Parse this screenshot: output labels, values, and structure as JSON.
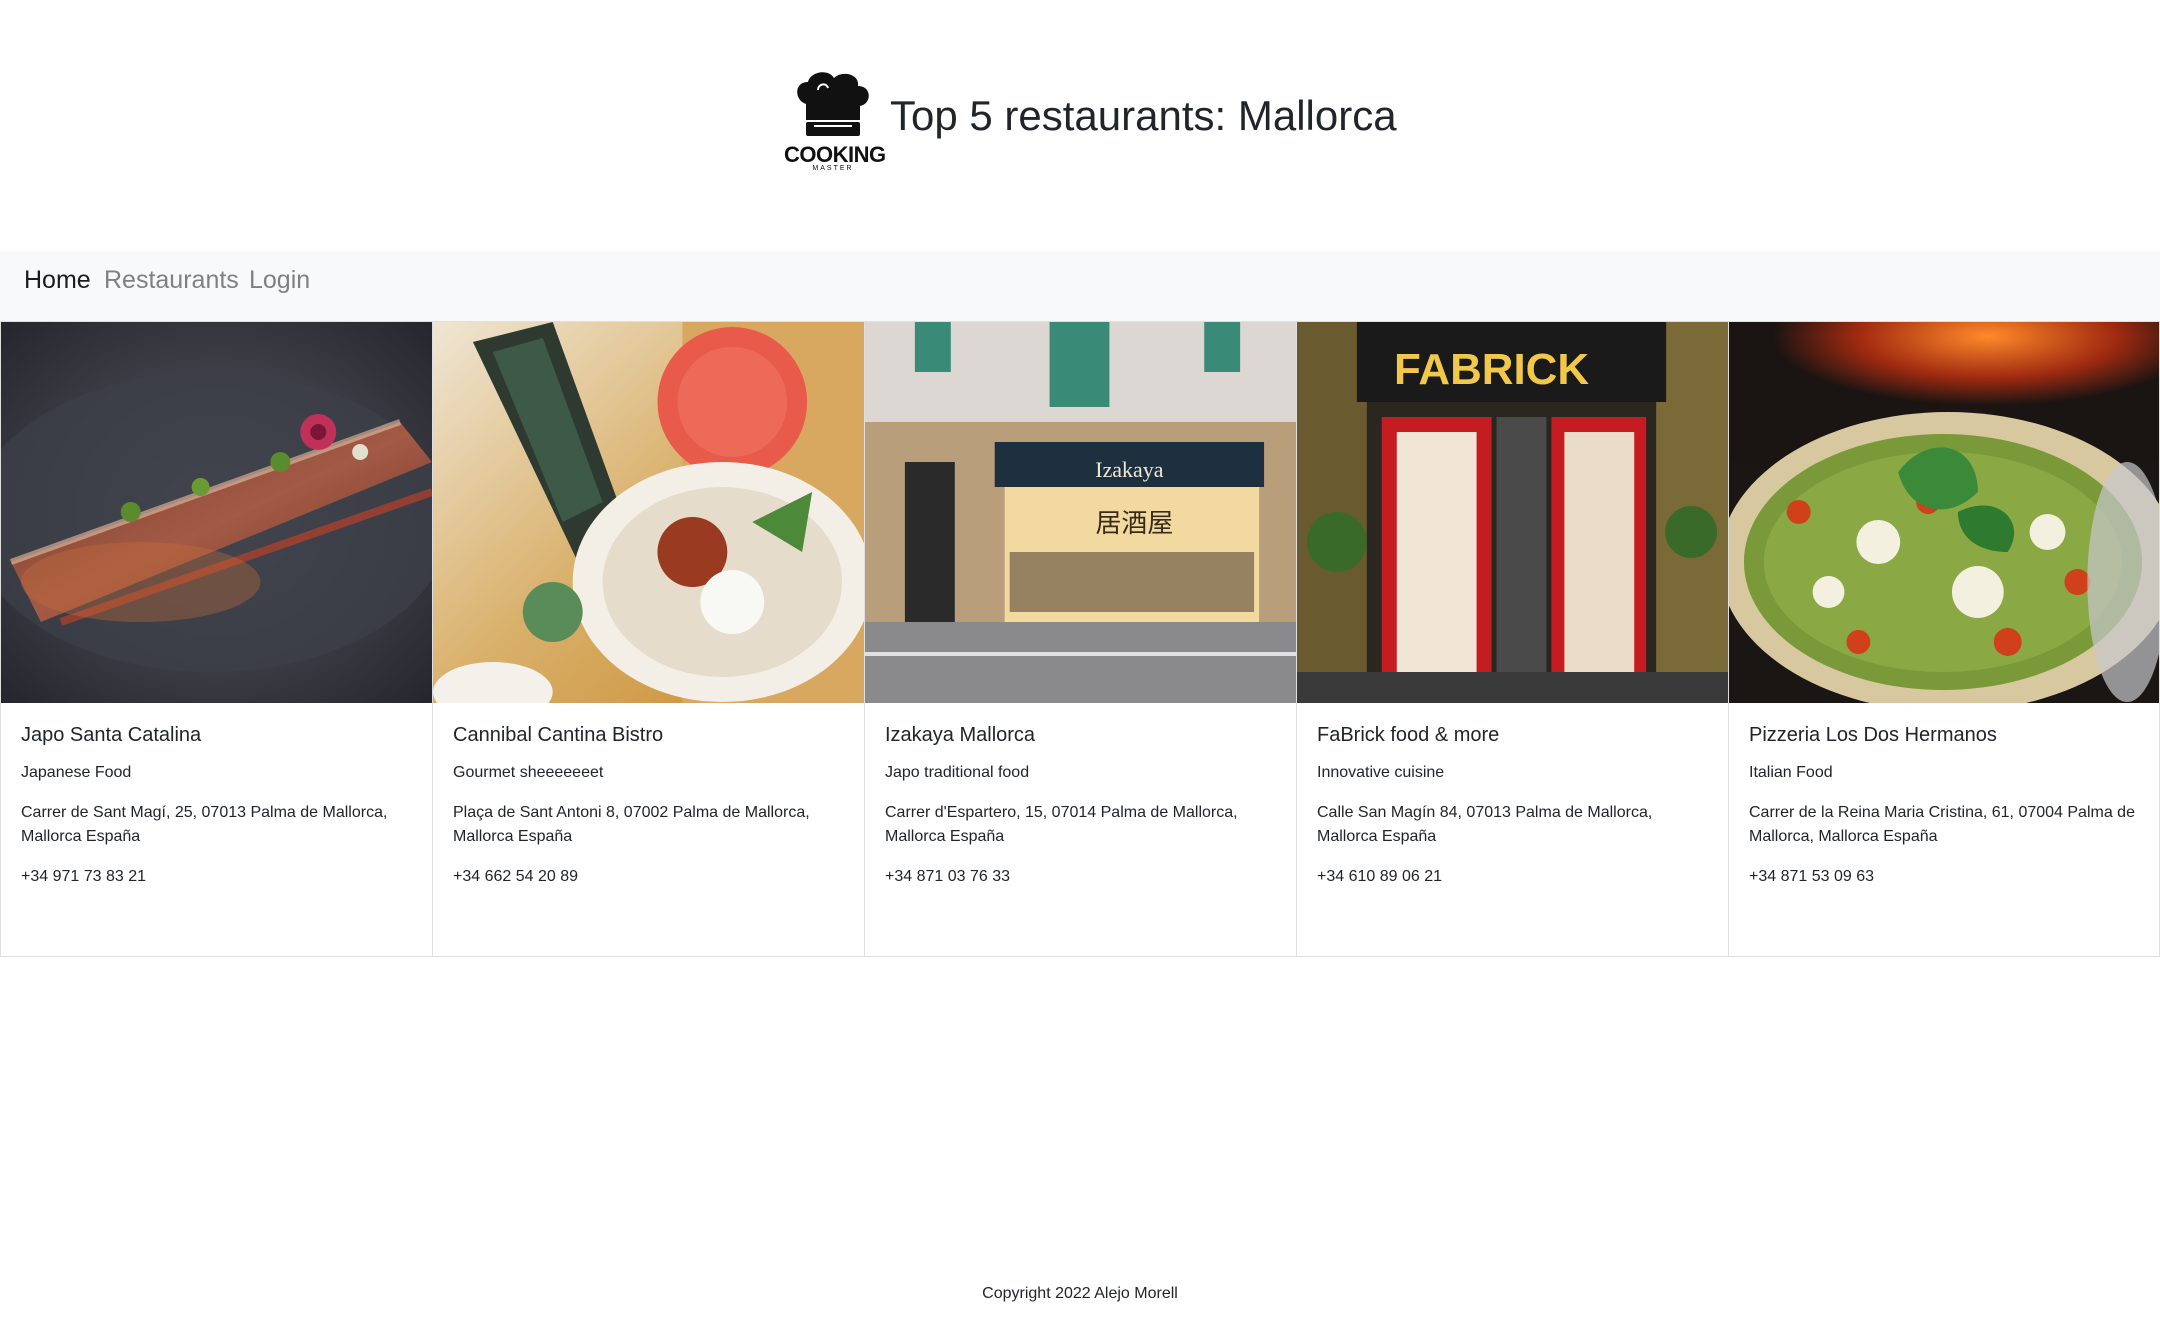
{
  "header": {
    "logo_text": "COOKING",
    "logo_sub": "MASTER",
    "title": "Top 5 restaurants: Mallorca"
  },
  "nav": {
    "items": [
      {
        "label": "Home",
        "active": true
      },
      {
        "label": "Restaurants",
        "active": false
      },
      {
        "label": "Login",
        "active": false
      }
    ]
  },
  "restaurants": [
    {
      "name": "Japo Santa Catalina",
      "cuisine": "Japanese Food",
      "address": "Carrer de Sant Magí, 25, 07013 Palma de Mallorca, Mallorca España",
      "phone": "+34 971 73 83 21",
      "image": "sushi-roll-photo"
    },
    {
      "name": "Cannibal Cantina Bistro",
      "cuisine": "Gourmet sheeeeeeet",
      "address": "Plaça de Sant Antoni 8, 07002 Palma de Mallorca, Mallorca España",
      "phone": "+34 662 54 20 89",
      "image": "drinks-and-dish-photo"
    },
    {
      "name": "Izakaya Mallorca",
      "cuisine": "Japo traditional food",
      "address": "Carrer d'Espartero, 15, 07014 Palma de Mallorca, Mallorca España",
      "phone": "+34 871 03 76 33",
      "image": "izakaya-storefront-photo"
    },
    {
      "name": "FaBrick food & more",
      "cuisine": "Innovative cuisine",
      "address": "Calle San Magín 84, 07013 Palma de Mallorca, Mallorca España",
      "phone": "+34 610 89 06 21",
      "image": "fabrick-storefront-photo"
    },
    {
      "name": "Pizzeria Los Dos Hermanos",
      "cuisine": "Italian Food",
      "address": "Carrer de la Reina Maria Cristina, 61, 07004 Palma de Mallorca, Mallorca España",
      "phone": "+34 871 53 09 63",
      "image": "pesto-pizza-photo"
    }
  ],
  "photo_text": {
    "izakaya_sign": "Izakaya",
    "izakaya_kanji": "居酒屋",
    "fabrick_sign": "FABRICK"
  },
  "footer": {
    "copyright": "Copyright 2022 Alejo Morell"
  },
  "colors": {
    "navbar_bg": "#f8f9fa",
    "nav_active": "#1c1c1c",
    "nav_muted": "#808080",
    "card_border": "#dfdfdf"
  }
}
